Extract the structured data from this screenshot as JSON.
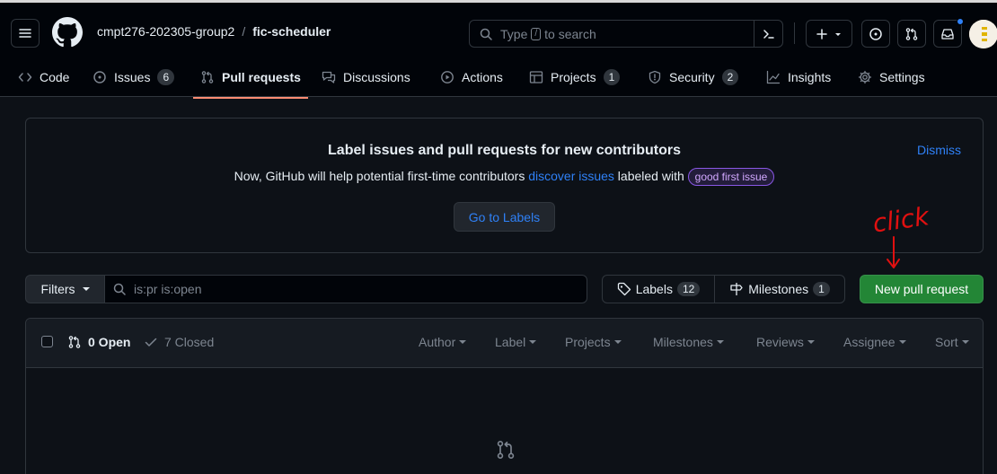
{
  "header": {
    "owner": "cmpt276-202305-group2",
    "separator": "/",
    "repo": "fic-scheduler",
    "search_prefix": "Type",
    "search_key": "/",
    "search_suffix": "to search",
    "notification_dot_color": "#2f81f7"
  },
  "tabs": [
    {
      "label": "Code",
      "icon": "code-icon"
    },
    {
      "label": "Issues",
      "icon": "issue-opened-icon",
      "count": "6"
    },
    {
      "label": "Pull requests",
      "icon": "git-pull-request-icon",
      "active": true
    },
    {
      "label": "Discussions",
      "icon": "comment-discussion-icon"
    },
    {
      "label": "Actions",
      "icon": "play-icon"
    },
    {
      "label": "Projects",
      "icon": "table-icon",
      "count": "1"
    },
    {
      "label": "Security",
      "icon": "shield-icon",
      "count": "2"
    },
    {
      "label": "Insights",
      "icon": "graph-icon"
    },
    {
      "label": "Settings",
      "icon": "gear-icon"
    }
  ],
  "banner": {
    "title": "Label issues and pull requests for new contributors",
    "text_before": "Now, GitHub will help potential first-time contributors ",
    "link_text": "discover issues",
    "text_after": " labeled with ",
    "label_badge": "good first issue",
    "dismiss": "Dismiss",
    "button": "Go to Labels"
  },
  "annotation": {
    "text": "click",
    "color": "#e01010"
  },
  "toolbar": {
    "filters_label": "Filters",
    "search_value": "is:pr is:open",
    "labels_label": "Labels",
    "labels_count": "12",
    "milestones_label": "Milestones",
    "milestones_count": "1",
    "new_pr_label": "New pull request",
    "primary_color": "#238636"
  },
  "list": {
    "open_label": "0 Open",
    "closed_label": "7 Closed",
    "filters": [
      "Author",
      "Label",
      "Projects",
      "Milestones",
      "Reviews",
      "Assignee",
      "Sort"
    ]
  },
  "theme": {
    "background": "#0d1117",
    "accent_link": "#2f81f7",
    "tab_underline": "#fd8c73"
  }
}
